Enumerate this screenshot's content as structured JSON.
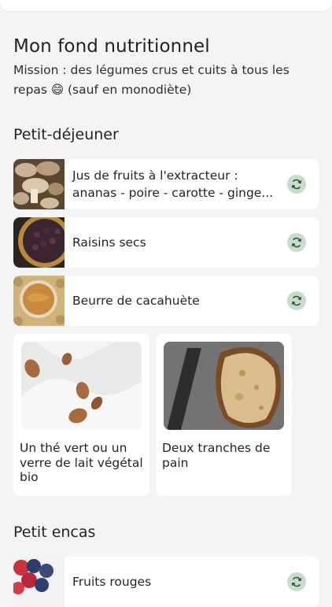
{
  "header": {
    "title": "Mon fond nutritionnel",
    "mission": "Mission : des légumes crus et cuits à tous les repas 😄 (sauf en monodiète)"
  },
  "sections": {
    "breakfast": {
      "title": "Petit-déjeuner",
      "rows": [
        {
          "label": "Jus de fruits à l'extracteur : ananas - poire - carotte - ginge...",
          "thumb": "mushrooms-photo"
        },
        {
          "label": "Raisins secs",
          "thumb": "raisins-photo"
        },
        {
          "label": "Beurre de cacahuète",
          "thumb": "peanut-butter-photo"
        }
      ],
      "cards": [
        {
          "label": "Un thé vert ou un verre de lait végétal bio",
          "photo": "almond-milk-photo"
        },
        {
          "label": "Deux tranches de pain",
          "photo": "bread-photo"
        }
      ]
    },
    "snack": {
      "title": "Petit encas",
      "rows": [
        {
          "label": "Fruits rouges",
          "thumb": "berries-photo"
        }
      ]
    }
  },
  "icons": {
    "refresh": "refresh-icon"
  },
  "colors": {
    "background": "#f4f4f5",
    "card": "#ffffff",
    "refresh_bg": "#c7dccb",
    "refresh_fg": "#2f5a3a"
  }
}
